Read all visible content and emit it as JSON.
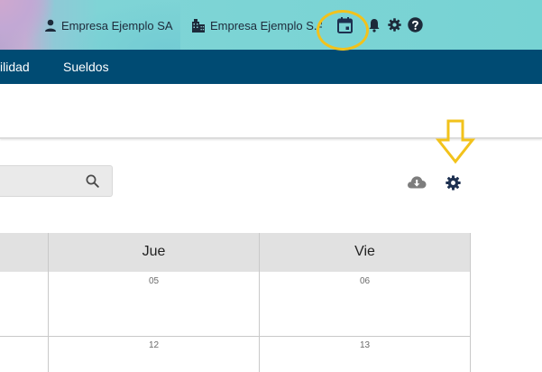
{
  "topbar": {
    "user_label": "Empresa Ejemplo SA",
    "company_label": "Empresa Ejemplo S.A.",
    "icons": [
      "user-icon",
      "building-icon",
      "calendar-icon",
      "bell-icon",
      "gear-icon",
      "help-icon"
    ]
  },
  "nav": {
    "items": [
      {
        "label": "ilidad"
      },
      {
        "label": "Sueldos"
      }
    ]
  },
  "toolbar": {
    "search_value": "",
    "icons": [
      "search-icon",
      "cloud-download-icon",
      "settings-icon"
    ]
  },
  "calendar": {
    "columns": [
      {
        "label": ""
      },
      {
        "label": "Jue"
      },
      {
        "label": "Vie"
      }
    ],
    "rows": [
      {
        "days": [
          "05",
          "06"
        ]
      },
      {
        "days": [
          "12",
          "13"
        ]
      }
    ]
  },
  "annotations": {
    "color": "#f2c21b",
    "marks": [
      "circle-around-calendar-icon",
      "arrow-pointing-to-settings-icon"
    ]
  },
  "colors": {
    "nav_bg": "#004b73",
    "header_bg": "#e1e1e1",
    "icon_dark": "#1d3050"
  }
}
